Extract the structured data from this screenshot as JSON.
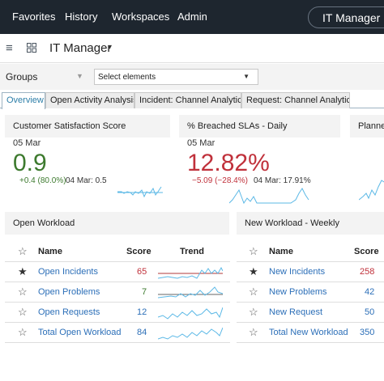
{
  "nav": {
    "items": [
      "Favorites",
      "History",
      "Workspaces",
      "Admin"
    ],
    "current": "IT Manager",
    "current_star": "☆"
  },
  "titlebar": {
    "menu_icon": "hamburger-icon",
    "grid_icon": "grid-icon",
    "title": "IT Manager",
    "caret": "▾"
  },
  "groups": {
    "label": "Groups",
    "select_value": "Select elements"
  },
  "tabs": [
    {
      "label": "Overview",
      "active": true
    },
    {
      "label": "Open Activity Analysis",
      "active": false
    },
    {
      "label": "Incident: Channel Analytics",
      "active": false
    },
    {
      "label": "Request: Channel Analytics",
      "active": false
    }
  ],
  "kpis": [
    {
      "title": "Customer Satisfaction Score",
      "date": "05 Mar",
      "value": "0.9",
      "change": "+0.4 (80.0%)",
      "prev": "04 Mar: 0.5",
      "color": "#3d7a2e"
    },
    {
      "title": "% Breached SLAs - Daily",
      "date": "05 Mar",
      "value": "12.82%",
      "change": "−5.09 (−28.4%)",
      "prev": "04 Mar: 17.91%",
      "color": "#c0313b"
    },
    {
      "title": "Planne",
      "date": "",
      "value": "",
      "change": "",
      "prev": "",
      "color": "#333"
    }
  ],
  "open_workload": {
    "title": "Open Workload",
    "headers": {
      "name": "Name",
      "score": "Score",
      "trend": "Trend"
    },
    "rows": [
      {
        "name": "Open Incidents",
        "score": "65",
        "favorite": true,
        "score_color": "#c0313b"
      },
      {
        "name": "Open Problems",
        "score": "7",
        "favorite": false,
        "score_color": "#3d7a2e"
      },
      {
        "name": "Open Requests",
        "score": "12",
        "favorite": false,
        "score_color": "#2c6fb8"
      },
      {
        "name": "Total Open Workload",
        "score": "84",
        "favorite": false,
        "score_color": "#2c6fb8"
      }
    ]
  },
  "new_workload": {
    "title": "New Workload - Weekly",
    "headers": {
      "name": "Name",
      "score": "Score"
    },
    "rows": [
      {
        "name": "New Incidents",
        "score": "258",
        "favorite": true,
        "score_color": "#c0313b"
      },
      {
        "name": "New Problems",
        "score": "42",
        "favorite": false,
        "score_color": "#2c6fb8"
      },
      {
        "name": "New Request",
        "score": "50",
        "favorite": false,
        "score_color": "#2c6fb8"
      },
      {
        "name": "Total New Workload",
        "score": "350",
        "favorite": false,
        "score_color": "#2c6fb8"
      }
    ]
  },
  "colors": {
    "nav_bg": "#1e262f",
    "link": "#2c6fb8",
    "spark": "#5bb8e6",
    "red_line": "#b23a3a",
    "grey_line": "#666666"
  }
}
